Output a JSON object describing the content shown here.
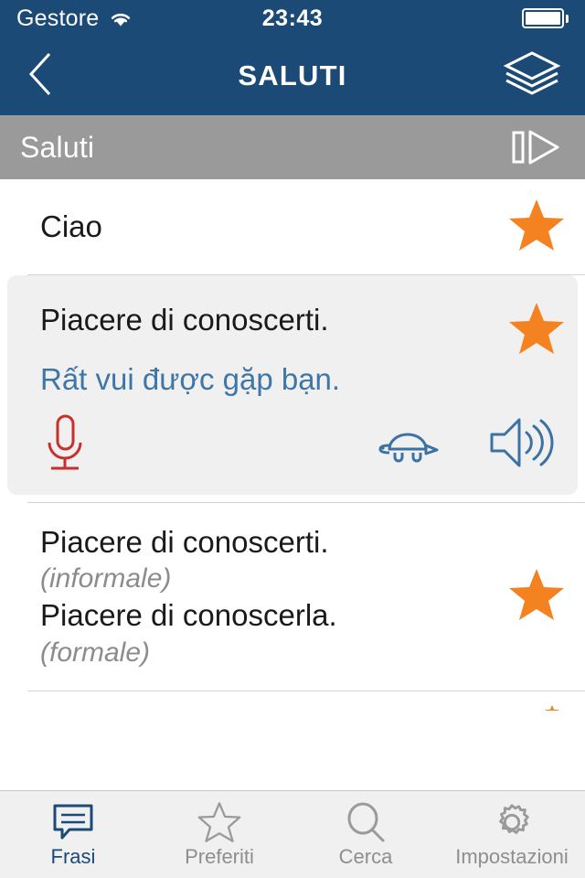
{
  "status_bar": {
    "carrier": "Gestore",
    "wifi_icon": "wifi-icon",
    "time": "23:43",
    "battery_icon": "battery-full-icon"
  },
  "nav_bar": {
    "back_icon": "chevron-left-icon",
    "title": "SALUTI",
    "layers_icon": "layers-icon"
  },
  "section_header": {
    "title": "Saluti",
    "play_all_icon": "play-all-icon"
  },
  "colors": {
    "navy": "#1b4a77",
    "header_gray": "#9a9a9a",
    "star_orange": "#f58220",
    "translation_blue": "#3f76a8",
    "mic_red": "#c9302c",
    "expanded_bg": "#f0f0f0"
  },
  "list": {
    "rows": [
      {
        "phrase": "Ciao",
        "favorite_icon": "star-filled-icon",
        "expanded": false
      },
      {
        "phrase": "Piacere di conoscerti.",
        "translation": "Rất vui được gặp bạn.",
        "favorite_icon": "star-filled-icon",
        "expanded": true,
        "actions": {
          "record_icon": "microphone-icon",
          "slow_play_icon": "turtle-slow-icon",
          "play_icon": "speaker-icon"
        }
      },
      {
        "phrase": "Piacere di conoscerti.",
        "register": "(informale)",
        "phrase2": "Piacere di conoscerla.",
        "register2": "(formale)",
        "favorite_icon": "star-filled-icon",
        "expanded": false
      }
    ]
  },
  "tab_bar": {
    "tabs": [
      {
        "label": "Frasi",
        "icon": "speech-bubble-icon",
        "active": true
      },
      {
        "label": "Preferiti",
        "icon": "star-outline-icon",
        "active": false
      },
      {
        "label": "Cerca",
        "icon": "search-icon",
        "active": false
      },
      {
        "label": "Impostazioni",
        "icon": "gear-icon",
        "active": false
      }
    ]
  }
}
